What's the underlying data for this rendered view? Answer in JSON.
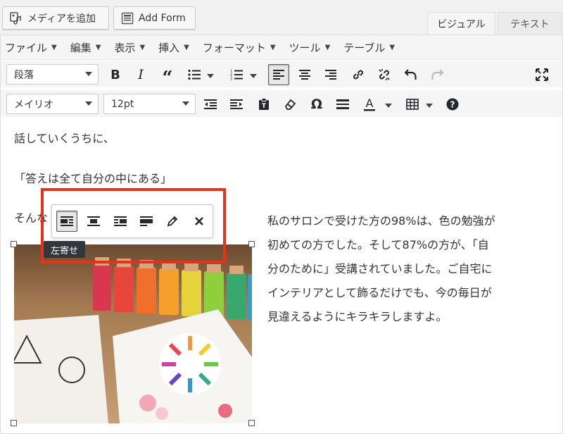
{
  "top_buttons": {
    "add_media": "メディアを追加",
    "add_form": "Add Form"
  },
  "tabs": {
    "visual": "ビジュアル",
    "text": "テキスト"
  },
  "menubar": [
    "ファイル",
    "編集",
    "表示",
    "挿入",
    "フォーマット",
    "ツール",
    "テーブル"
  ],
  "toolbar1": {
    "format_select": "段落"
  },
  "toolbar2": {
    "font_select": "メイリオ",
    "size_select": "12pt"
  },
  "content": {
    "line1": "話していくうちに、",
    "line2": "「答えは全て自分の中にある」",
    "line3": "そんな",
    "side_lines": [
      "私のサロンで受けた方の98%は、色の勉強が",
      "初めての方でした。そして87%の方が、「自",
      "分のために」受講されていました。ご自宅に",
      "インテリアとして飾るだけでも、今の毎日が",
      "見違えるようにキラキラしますよ。"
    ]
  },
  "image_toolbar": {
    "tooltip": "左寄せ"
  },
  "colors": {
    "highlight": "#e8311a",
    "tooltip_bg": "#32373c"
  }
}
